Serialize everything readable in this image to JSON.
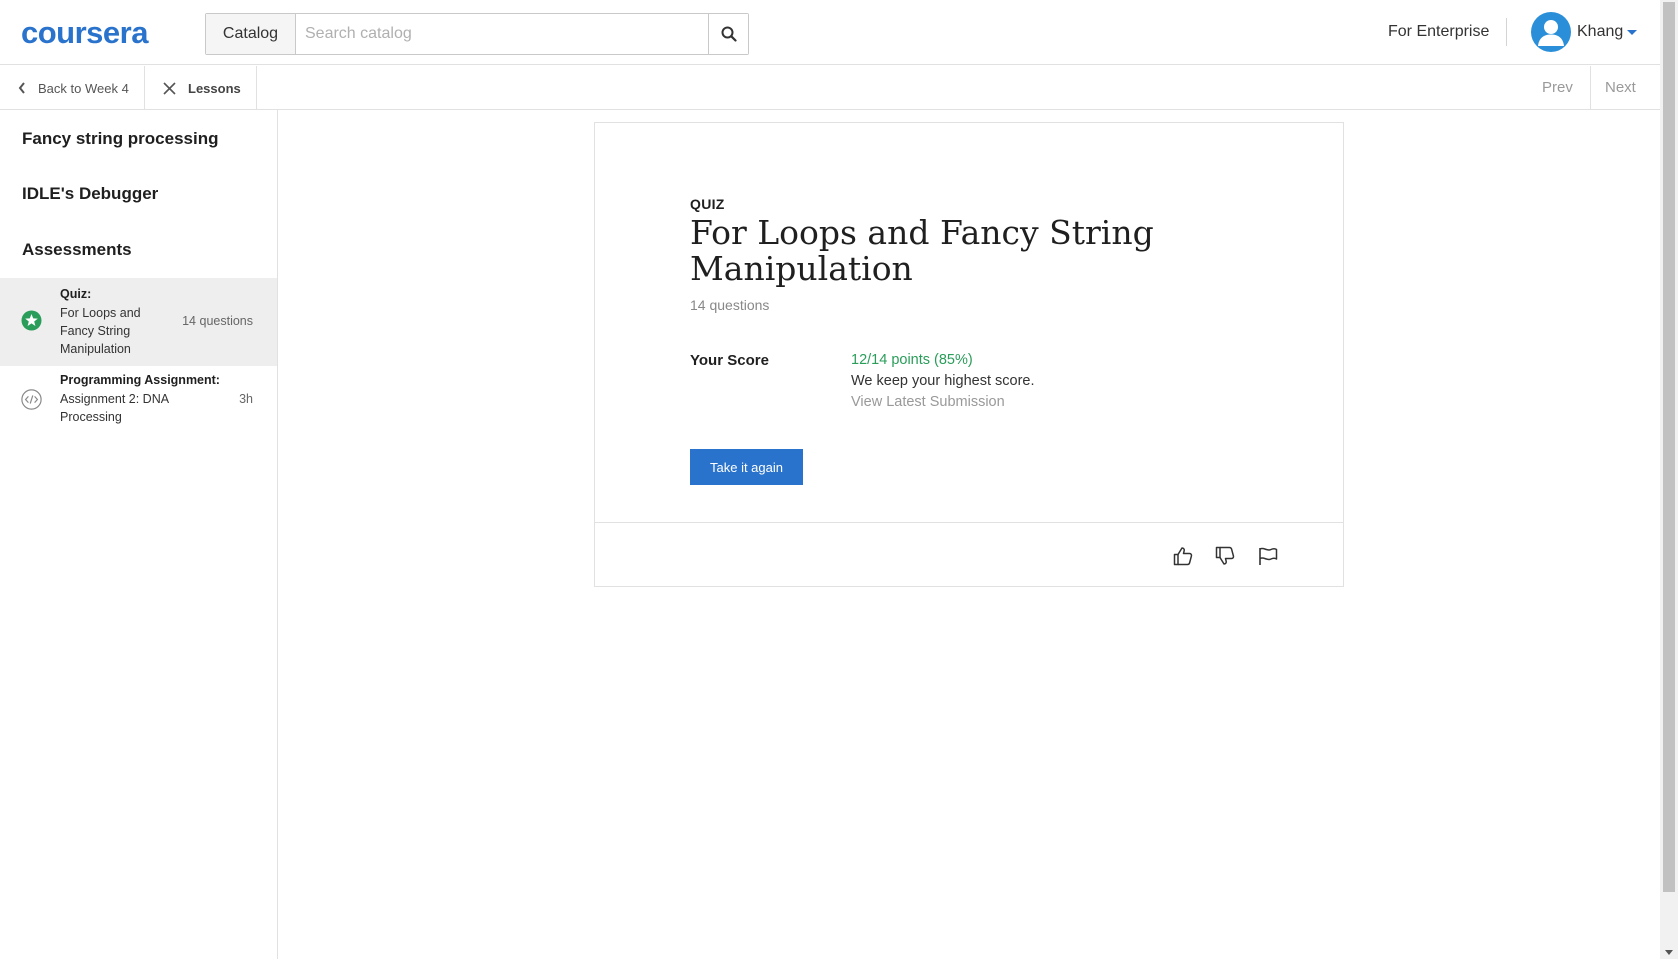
{
  "header": {
    "logo": "coursera",
    "catalog_label": "Catalog",
    "search_placeholder": "Search catalog",
    "search_icon": "search-icon",
    "enterprise_label": "For Enterprise",
    "user_name": "Khang",
    "avatar_icon": "user-avatar-icon"
  },
  "subnav": {
    "back_label": "Back to Week 4",
    "lessons_label": "Lessons",
    "prev_label": "Prev",
    "next_label": "Next"
  },
  "sidebar": {
    "sections": [
      {
        "title": "Fancy string processing"
      },
      {
        "title": "IDLE's Debugger"
      },
      {
        "title": "Assessments"
      }
    ],
    "items": [
      {
        "type": "Quiz:",
        "name_lines": [
          "For Loops and",
          "Fancy String",
          "Manipulation"
        ],
        "meta": "14 questions",
        "icon": "completed-star-icon",
        "active": true
      },
      {
        "type": "Programming Assignment:",
        "name_lines": [
          "Assignment 2: DNA",
          "Processing"
        ],
        "meta": "3h",
        "icon": "code-icon",
        "active": false
      }
    ]
  },
  "quiz": {
    "label": "QUIZ",
    "title_lines": [
      "For Loops and Fancy String",
      "Manipulation"
    ],
    "question_count": "14 questions",
    "score_label": "Your Score",
    "score_value": "12/14 points (85%)",
    "score_note": "We keep your highest score.",
    "view_submission": "View Latest Submission",
    "retake_button": "Take it again"
  },
  "feedback": {
    "icons": [
      "thumbs-up-icon",
      "thumbs-down-icon",
      "flag-icon"
    ]
  },
  "colors": {
    "brand": "#2a73cc",
    "success": "#2a9d5a",
    "active_bg": "#eeeeee"
  }
}
